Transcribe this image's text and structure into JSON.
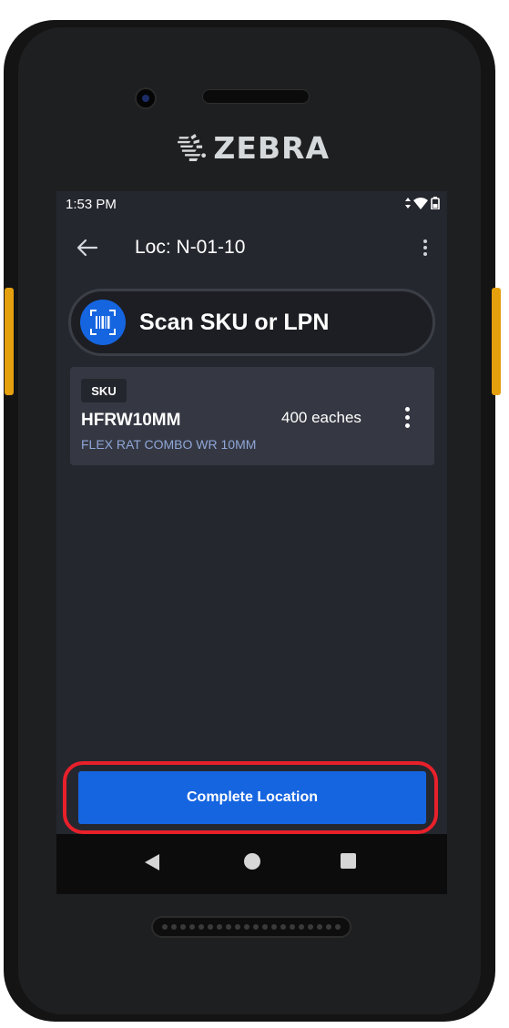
{
  "device": {
    "brand": "ZEBRA"
  },
  "status_bar": {
    "time": "1:53 PM"
  },
  "app_bar": {
    "title": "Loc: N-01-10"
  },
  "scan": {
    "label": "Scan SKU or LPN"
  },
  "items": [
    {
      "badge": "SKU",
      "code": "HFRW10MM",
      "quantity": "400 eaches",
      "description": "FLEX RAT COMBO WR 10MM"
    }
  ],
  "actions": {
    "complete_label": "Complete Location"
  },
  "colors": {
    "accent": "#1565e0",
    "screen_bg": "#25272f",
    "card_bg": "#353842",
    "description_text": "#8fa6d8",
    "highlight": "#e8202a"
  }
}
